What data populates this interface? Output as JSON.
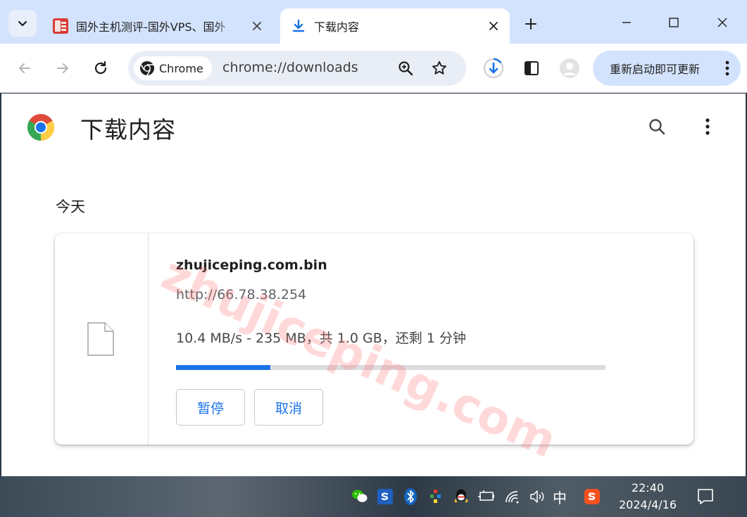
{
  "tabs": [
    {
      "title": "国外主机测评-国外VPS、国外",
      "active": false
    },
    {
      "title": "下载内容",
      "active": true
    }
  ],
  "toolbar": {
    "chip_label": "Chrome",
    "url": "chrome://downloads",
    "update_label": "重新启动即可更新"
  },
  "page": {
    "title": "下载内容",
    "section": "今天"
  },
  "download": {
    "filename": "zhujiceping.com.bin",
    "source": "http://66.78.38.254",
    "status": "10.4 MB/s - 235 MB，共 1.0 GB，还剩 1 分钟",
    "progress_percent": 22,
    "pause_label": "暂停",
    "cancel_label": "取消"
  },
  "watermark": "zhujiceping.com",
  "taskbar": {
    "ime": "中",
    "time": "22:40",
    "date": "2024/4/16"
  },
  "colors": {
    "accent": "#1a73e8",
    "tabstrip": "#d3e3fd",
    "omnibox": "#e9eef6"
  }
}
